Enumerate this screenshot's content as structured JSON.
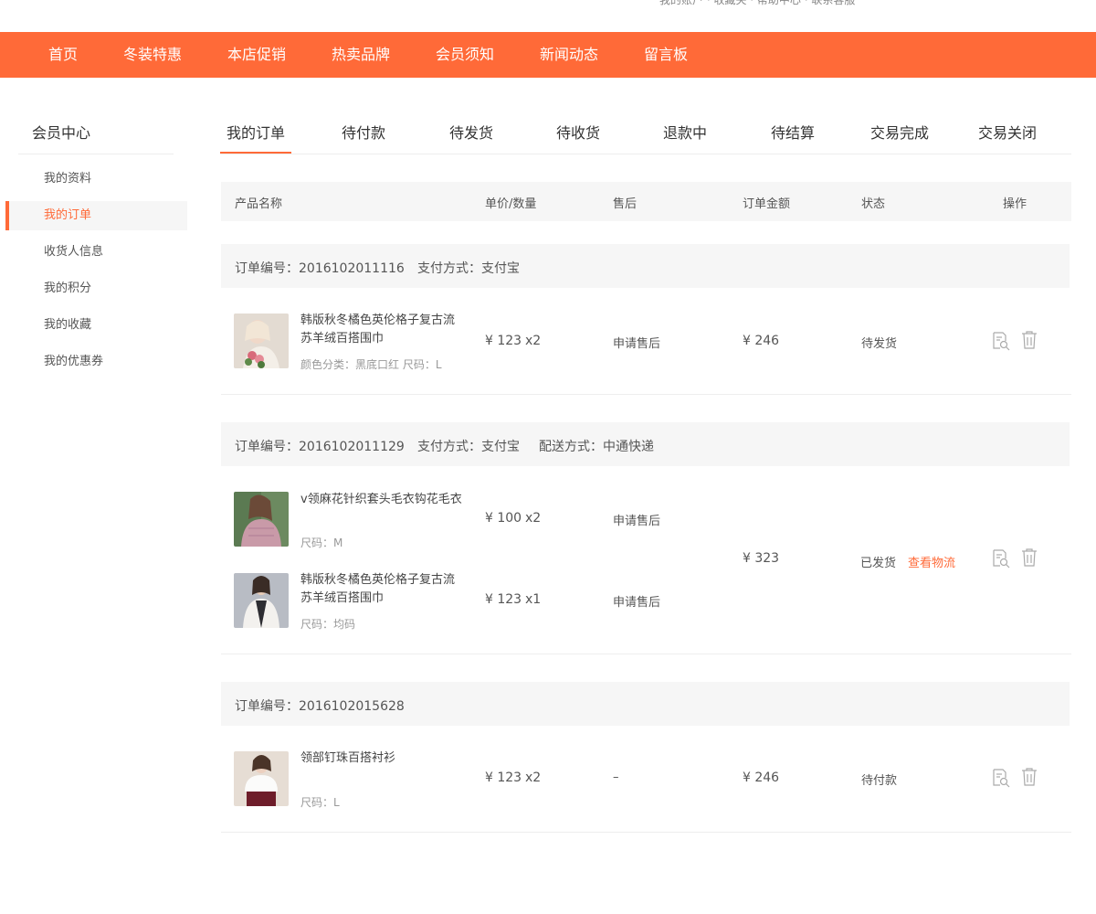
{
  "topbar": {
    "links_text": "我的账户  ·  收藏夹  ·  帮助中心  ·  联系客服"
  },
  "nav": {
    "items": [
      "首页",
      "冬装特惠",
      "本店促销",
      "热卖品牌",
      "会员须知",
      "新闻动态",
      "留言板"
    ]
  },
  "sidebar": {
    "title": "会员中心",
    "items": [
      "我的资料",
      "我的订单",
      "收货人信息",
      "我的积分",
      "我的收藏",
      "我的优惠券"
    ],
    "active": "我的订单"
  },
  "tabs": [
    "我的订单",
    "待付款",
    "待发货",
    "待收货",
    "退款中",
    "待结算",
    "交易完成",
    "交易关闭"
  ],
  "table_header": {
    "name": "产品名称",
    "price_qty": "单价/数量",
    "after_sale": "售后",
    "amount": "订单金额",
    "status": "状态",
    "ops": "操作"
  },
  "orders": [
    {
      "number_label": "订单编号：2016102011116",
      "payment_label": "支付方式：支付宝",
      "items": [
        {
          "name": "韩版秋冬橘色英伦格子复古流苏羊绒百搭围巾",
          "attrs": "颜色分类：黑底口红    尺码：L",
          "price": "¥ 123",
          "qty": "x2",
          "after_sale": "申请售后"
        }
      ],
      "amount": "¥ 246",
      "status": "待发货"
    },
    {
      "number_label": "订单编号：2016102011129",
      "payment_label": "支付方式：支付宝",
      "delivery_label": "配送方式：中通快递",
      "items": [
        {
          "name": "v领麻花针织套头毛衣钩花毛衣",
          "attrs": "尺码：M",
          "price": "¥ 100",
          "qty": "x2",
          "after_sale": "申请售后"
        },
        {
          "name": "韩版秋冬橘色英伦格子复古流苏羊绒百搭围巾",
          "attrs": "尺码：均码",
          "price": "¥ 123",
          "qty": "x1",
          "after_sale": "申请售后"
        }
      ],
      "amount": "¥ 323",
      "status": "已发货",
      "status_link": "查看物流"
    },
    {
      "number_label": "订单编号：2016102015628",
      "items": [
        {
          "name": "领部钉珠百搭衬衫",
          "attrs": "尺码：L",
          "price": "¥ 123",
          "qty": "x2",
          "after_sale": "–"
        }
      ],
      "amount": "¥ 246",
      "status": "待付款"
    }
  ],
  "colors": {
    "accent": "#ff6a38",
    "header_bg": "#f6f6f6"
  },
  "icons": {
    "view": "view-order-icon",
    "delete": "trash-icon"
  }
}
